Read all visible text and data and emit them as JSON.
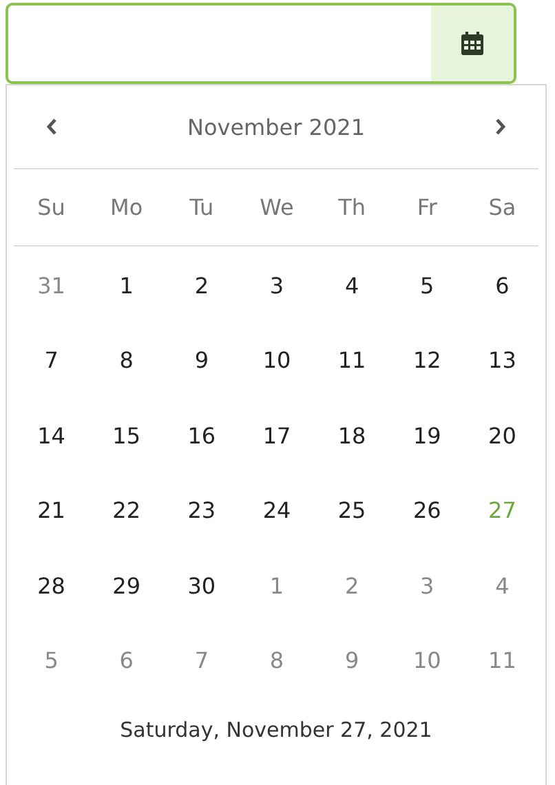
{
  "calendar": {
    "title": "November 2021",
    "weekdays": [
      "Su",
      "Mo",
      "Tu",
      "We",
      "Th",
      "Fr",
      "Sa"
    ],
    "weeks": [
      [
        {
          "day": "31",
          "outside_month": true,
          "selected": false
        },
        {
          "day": "1",
          "outside_month": false,
          "selected": false
        },
        {
          "day": "2",
          "outside_month": false,
          "selected": false
        },
        {
          "day": "3",
          "outside_month": false,
          "selected": false
        },
        {
          "day": "4",
          "outside_month": false,
          "selected": false
        },
        {
          "day": "5",
          "outside_month": false,
          "selected": false
        },
        {
          "day": "6",
          "outside_month": false,
          "selected": false
        }
      ],
      [
        {
          "day": "7",
          "outside_month": false,
          "selected": false
        },
        {
          "day": "8",
          "outside_month": false,
          "selected": false
        },
        {
          "day": "9",
          "outside_month": false,
          "selected": false
        },
        {
          "day": "10",
          "outside_month": false,
          "selected": false
        },
        {
          "day": "11",
          "outside_month": false,
          "selected": false
        },
        {
          "day": "12",
          "outside_month": false,
          "selected": false
        },
        {
          "day": "13",
          "outside_month": false,
          "selected": false
        }
      ],
      [
        {
          "day": "14",
          "outside_month": false,
          "selected": false
        },
        {
          "day": "15",
          "outside_month": false,
          "selected": false
        },
        {
          "day": "16",
          "outside_month": false,
          "selected": false
        },
        {
          "day": "17",
          "outside_month": false,
          "selected": false
        },
        {
          "day": "18",
          "outside_month": false,
          "selected": false
        },
        {
          "day": "19",
          "outside_month": false,
          "selected": false
        },
        {
          "day": "20",
          "outside_month": false,
          "selected": false
        }
      ],
      [
        {
          "day": "21",
          "outside_month": false,
          "selected": false
        },
        {
          "day": "22",
          "outside_month": false,
          "selected": false
        },
        {
          "day": "23",
          "outside_month": false,
          "selected": false
        },
        {
          "day": "24",
          "outside_month": false,
          "selected": false
        },
        {
          "day": "25",
          "outside_month": false,
          "selected": false
        },
        {
          "day": "26",
          "outside_month": false,
          "selected": false
        },
        {
          "day": "27",
          "outside_month": false,
          "selected": true
        }
      ],
      [
        {
          "day": "28",
          "outside_month": false,
          "selected": false
        },
        {
          "day": "29",
          "outside_month": false,
          "selected": false
        },
        {
          "day": "30",
          "outside_month": false,
          "selected": false
        },
        {
          "day": "1",
          "outside_month": true,
          "selected": false
        },
        {
          "day": "2",
          "outside_month": true,
          "selected": false
        },
        {
          "day": "3",
          "outside_month": true,
          "selected": false
        },
        {
          "day": "4",
          "outside_month": true,
          "selected": false
        }
      ],
      [
        {
          "day": "5",
          "outside_month": true,
          "selected": false
        },
        {
          "day": "6",
          "outside_month": true,
          "selected": false
        },
        {
          "day": "7",
          "outside_month": true,
          "selected": false
        },
        {
          "day": "8",
          "outside_month": true,
          "selected": false
        },
        {
          "day": "9",
          "outside_month": true,
          "selected": false
        },
        {
          "day": "10",
          "outside_month": true,
          "selected": false
        },
        {
          "day": "11",
          "outside_month": true,
          "selected": false
        }
      ]
    ],
    "footer": "Saturday, November 27, 2021"
  }
}
